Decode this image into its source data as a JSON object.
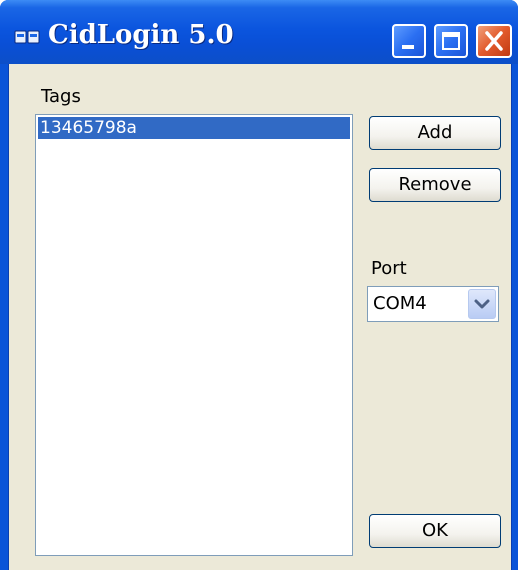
{
  "window": {
    "title": "CidLogin 5.0",
    "icon": "app-card-icon"
  },
  "titlebar_buttons": {
    "minimize_icon": "minimize-icon",
    "maximize_icon": "maximize-icon",
    "close_icon": "close-icon"
  },
  "tags": {
    "label": "Tags",
    "items": [
      "13465798a"
    ],
    "selected_index": 0
  },
  "buttons": {
    "add_label": "Add",
    "remove_label": "Remove",
    "ok_label": "OK"
  },
  "port": {
    "label": "Port",
    "selected": "COM4",
    "dropdown_icon": "chevron-down-icon"
  },
  "colors": {
    "titlebar": "#0a54d8",
    "selection": "#316ac5",
    "close_button": "#e25a2c",
    "client_background": "#ece9d8"
  }
}
